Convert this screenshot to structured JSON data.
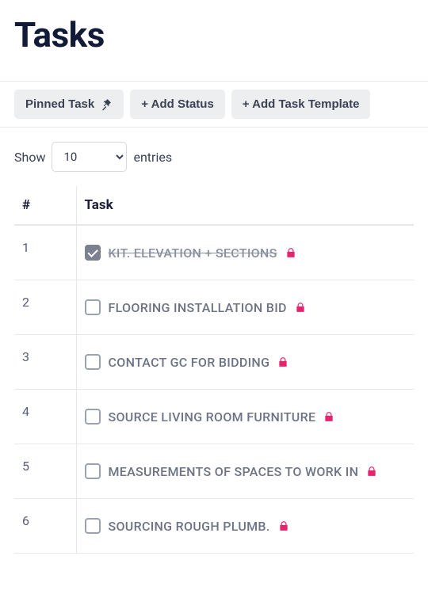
{
  "page_title": "Tasks",
  "toolbar": {
    "pinned_label": "Pinned Task",
    "add_status_label": "+ Add Status",
    "add_template_label": "+ Add Task Template"
  },
  "length": {
    "show_label": "Show",
    "entries_label": "entries",
    "selected": "10"
  },
  "table": {
    "col_number": "#",
    "col_task": "Task"
  },
  "tasks": [
    {
      "num": "1",
      "label": "KIT. ELEVATION + SECTIONS",
      "checked": true,
      "locked": true
    },
    {
      "num": "2",
      "label": "FLOORING INSTALLATION BID",
      "checked": false,
      "locked": true
    },
    {
      "num": "3",
      "label": "CONTACT GC FOR BIDDING",
      "checked": false,
      "locked": true
    },
    {
      "num": "4",
      "label": "SOURCE LIVING ROOM FURNITURE",
      "checked": false,
      "locked": true
    },
    {
      "num": "5",
      "label": "MEASUREMENTS OF SPACES TO WORK IN",
      "checked": false,
      "locked": true
    },
    {
      "num": "6",
      "label": "SOURCING ROUGH PLUMB.",
      "checked": false,
      "locked": true
    }
  ],
  "colors": {
    "lock": "#e6236d",
    "text_primary": "#1a2137",
    "text_muted": "#6c7385",
    "button_bg": "#eceef0"
  }
}
